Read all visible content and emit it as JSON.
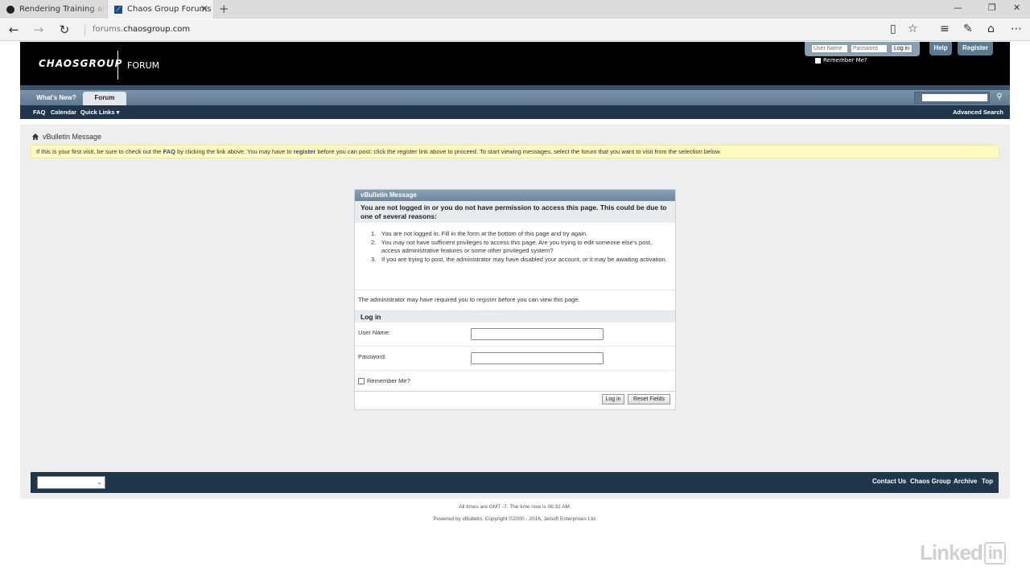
{
  "browser": {
    "tabs": [
      {
        "title": "Rendering Training and Tuto",
        "active": false
      },
      {
        "title": "Chaos Group Forums",
        "active": true
      }
    ],
    "new_tab_icon": "plus-icon",
    "address": {
      "prefix": "forums.",
      "domain": "chaosgroup.com",
      "suffix": ".com"
    },
    "url_display_host": "forums.",
    "url_display_main": "chaosgroup.com"
  },
  "header": {
    "logo": "CHAOSGROUP",
    "section": "FORUM",
    "login": {
      "username_placeholder": "User Name",
      "password_placeholder": "Password",
      "login_btn": "Log in",
      "remember": "Remember Me?"
    },
    "help_btn": "Help",
    "register_btn": "Register"
  },
  "nav": {
    "tabs": [
      "What's New?",
      "Forum"
    ],
    "active_tab": "Forum",
    "sublinks": [
      "FAQ",
      "Calendar",
      "Quick Links"
    ],
    "advanced_search": "Advanced Search"
  },
  "breadcrumb": "vBulletin Message",
  "notice": {
    "part1": "If this is your first visit, be sure to check out the ",
    "faq": "FAQ",
    "part2": " by clicking the link above. You may have to ",
    "register": "register",
    "part3": " before you can post: click the register link above to proceed. To start viewing messages, select the forum that you want to visit from the selection below."
  },
  "message": {
    "title": "vBulletin Message",
    "heading": "You are not logged in or you do not have permission to access this page. This could be due to one of several reasons:",
    "reasons": [
      "You are not logged in. Fill in the form at the bottom of this page and try again.",
      "You may not have sufficient privileges to access this page. Are you trying to edit someone else's post, access administrative features or some other privileged system?",
      "If you are trying to post, the administrator may have disabled your account, or it may be awaiting activation."
    ],
    "admin_note_before": "The administrator may have required you to ",
    "admin_note_link": "register",
    "admin_note_after": " before you can view this page.",
    "login_heading": "Log in",
    "username_label": "User Name:",
    "password_label": "Password:",
    "remember_label": "Remember Me?",
    "login_btn": "Log in",
    "reset_btn": "Reset Fields"
  },
  "footer": {
    "links": [
      "Contact Us",
      "Chaos Group",
      "Archive",
      "Top"
    ],
    "times": "All times are GMT -7. The time now is 06:32 AM.",
    "powered": "Powered by vBulletin, Copyright ©2000 - 2016, Jelsoft Enterprises Ltd."
  },
  "watermark": {
    "text": "Linked",
    "badge": "in"
  }
}
